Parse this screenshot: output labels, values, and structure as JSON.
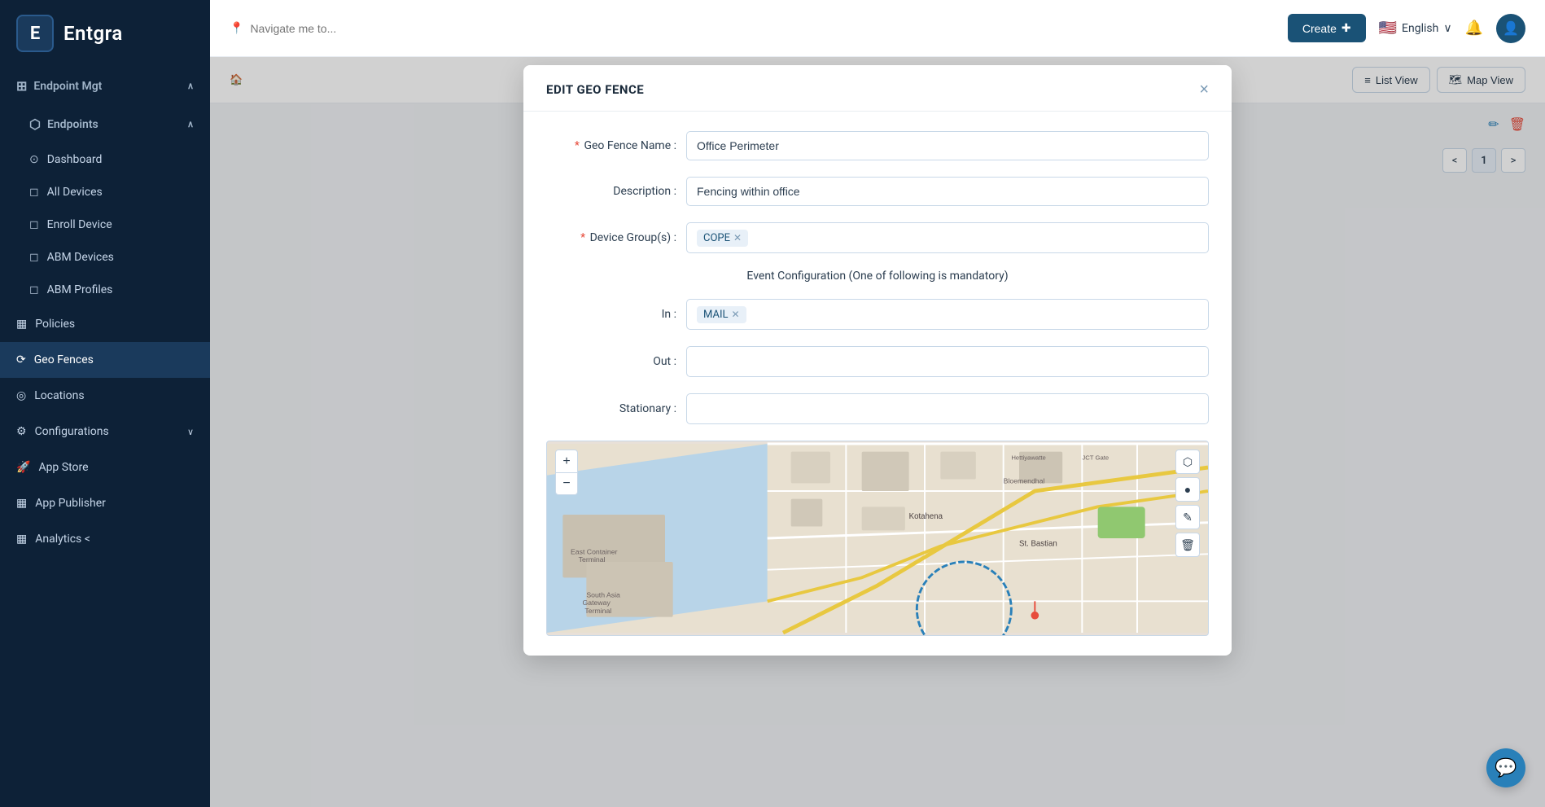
{
  "app": {
    "name": "Entgra",
    "logo_letter": "E"
  },
  "sidebar": {
    "sections": [
      {
        "id": "endpoint-mgt",
        "label": "Endpoint Mgt",
        "expanded": true,
        "icon": "⊞",
        "subsections": [
          {
            "id": "endpoints",
            "label": "Endpoints",
            "icon": "⬡",
            "expanded": true,
            "items": [
              {
                "id": "dashboard",
                "label": "Dashboard",
                "icon": "⊙",
                "active": false
              },
              {
                "id": "all-devices",
                "label": "All Devices",
                "icon": "",
                "active": false
              },
              {
                "id": "enroll-device",
                "label": "Enroll Device",
                "icon": "",
                "active": false
              },
              {
                "id": "abm-devices",
                "label": "ABM Devices",
                "icon": "",
                "active": false
              },
              {
                "id": "abm-profiles",
                "label": "ABM Profiles",
                "icon": "",
                "active": false
              }
            ]
          }
        ]
      }
    ],
    "standalone_items": [
      {
        "id": "policies",
        "label": "Policies",
        "icon": "▦",
        "active": false
      },
      {
        "id": "geo-fences",
        "label": "Geo Fences",
        "icon": "⟳",
        "active": true
      },
      {
        "id": "locations",
        "label": "Locations",
        "icon": "◎",
        "active": false
      },
      {
        "id": "configurations",
        "label": "Configurations",
        "icon": "⚙",
        "active": false,
        "has_chevron": true
      },
      {
        "id": "app-store",
        "label": "App Store",
        "icon": "🚀",
        "active": false
      },
      {
        "id": "app-publisher",
        "label": "App Publisher",
        "icon": "▦",
        "active": false
      },
      {
        "id": "analytics",
        "label": "Analytics <",
        "icon": "▦",
        "active": false
      }
    ]
  },
  "header": {
    "search_placeholder": "Navigate me to...",
    "create_label": "Create",
    "lang": "English",
    "flag": "🇺🇸"
  },
  "content": {
    "view_toggle": {
      "list_view": "List View",
      "map_view": "Map View"
    },
    "pagination": {
      "prev": "<",
      "next": ">",
      "current_page": "1"
    }
  },
  "modal": {
    "title": "EDIT GEO FENCE",
    "close_label": "×",
    "fields": {
      "geo_fence_name_label": "Geo Fence Name :",
      "geo_fence_name_value": "Office Perimeter",
      "description_label": "Description :",
      "description_value": "Fencing within office",
      "device_groups_label": "Device Group(s) :",
      "device_groups_tag": "COPE",
      "event_config_label": "Event Configuration (One of following is mandatory)",
      "in_label": "In :",
      "in_tag": "MAIL",
      "out_label": "Out :",
      "out_value": "",
      "stationary_label": "Stationary :",
      "stationary_value": ""
    }
  },
  "map": {
    "zoom_in": "+",
    "zoom_out": "−",
    "tools": [
      "⬡",
      "●",
      "✎",
      "🗑"
    ]
  }
}
